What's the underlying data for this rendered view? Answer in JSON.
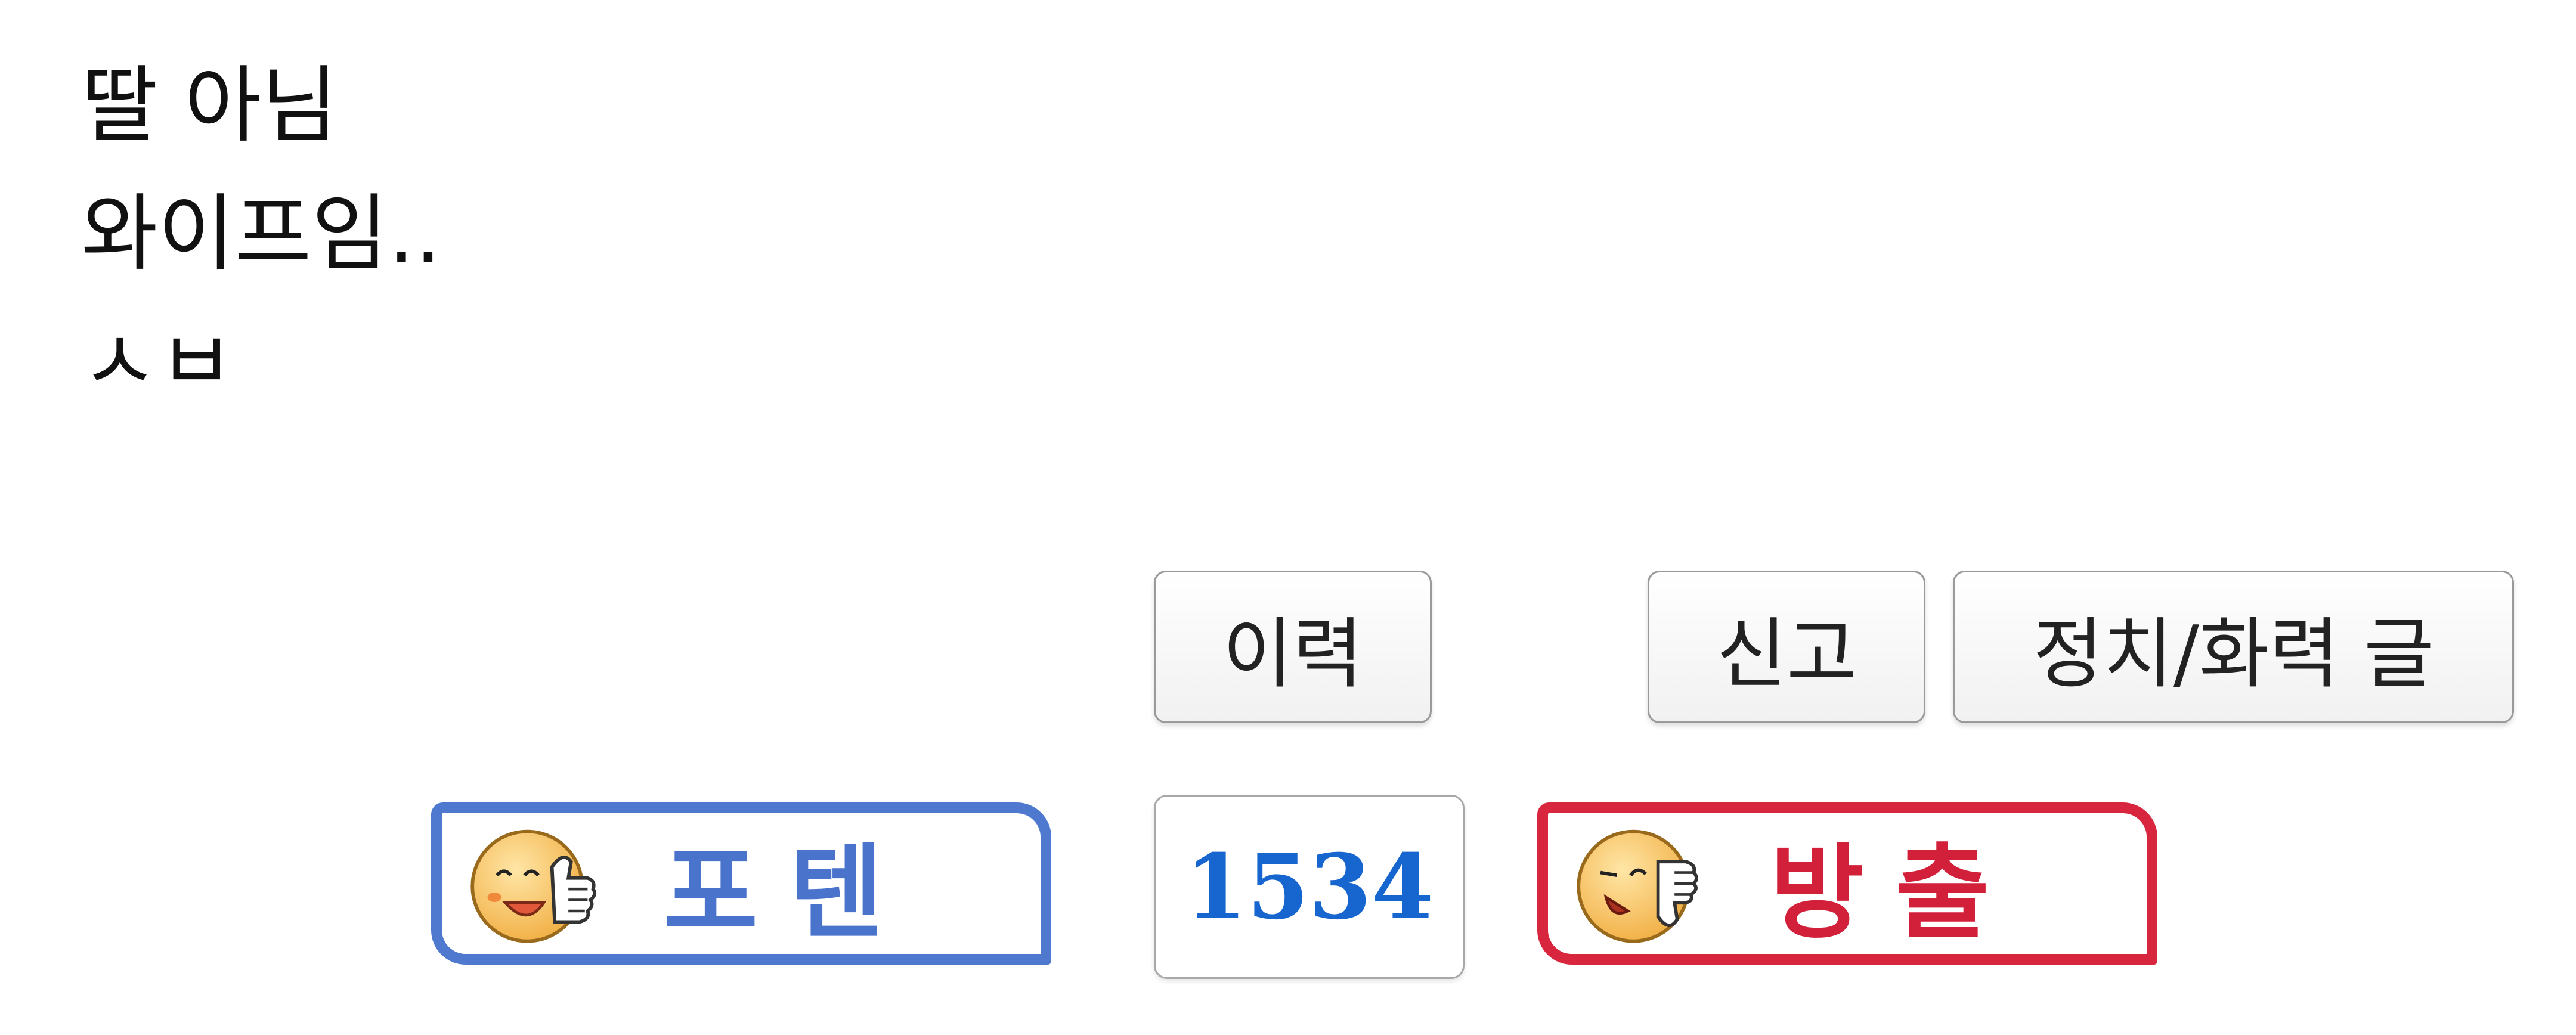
{
  "post": {
    "lines": [
      "딸 아님",
      "와이프임..",
      "ㅅㅂ"
    ]
  },
  "actions": {
    "history_label": "이력",
    "report_label": "신고",
    "politics_label": "정치/화력 글"
  },
  "vote": {
    "up_label": "포텐",
    "count": "1534",
    "down_label": "방출",
    "up_icon": "smiley-thumbs-up-icon",
    "down_icon": "smiley-thumbs-down-icon"
  },
  "colors": {
    "up_accent": "#4f79cf",
    "down_accent": "#d7263d",
    "count_text": "#1766cf"
  }
}
